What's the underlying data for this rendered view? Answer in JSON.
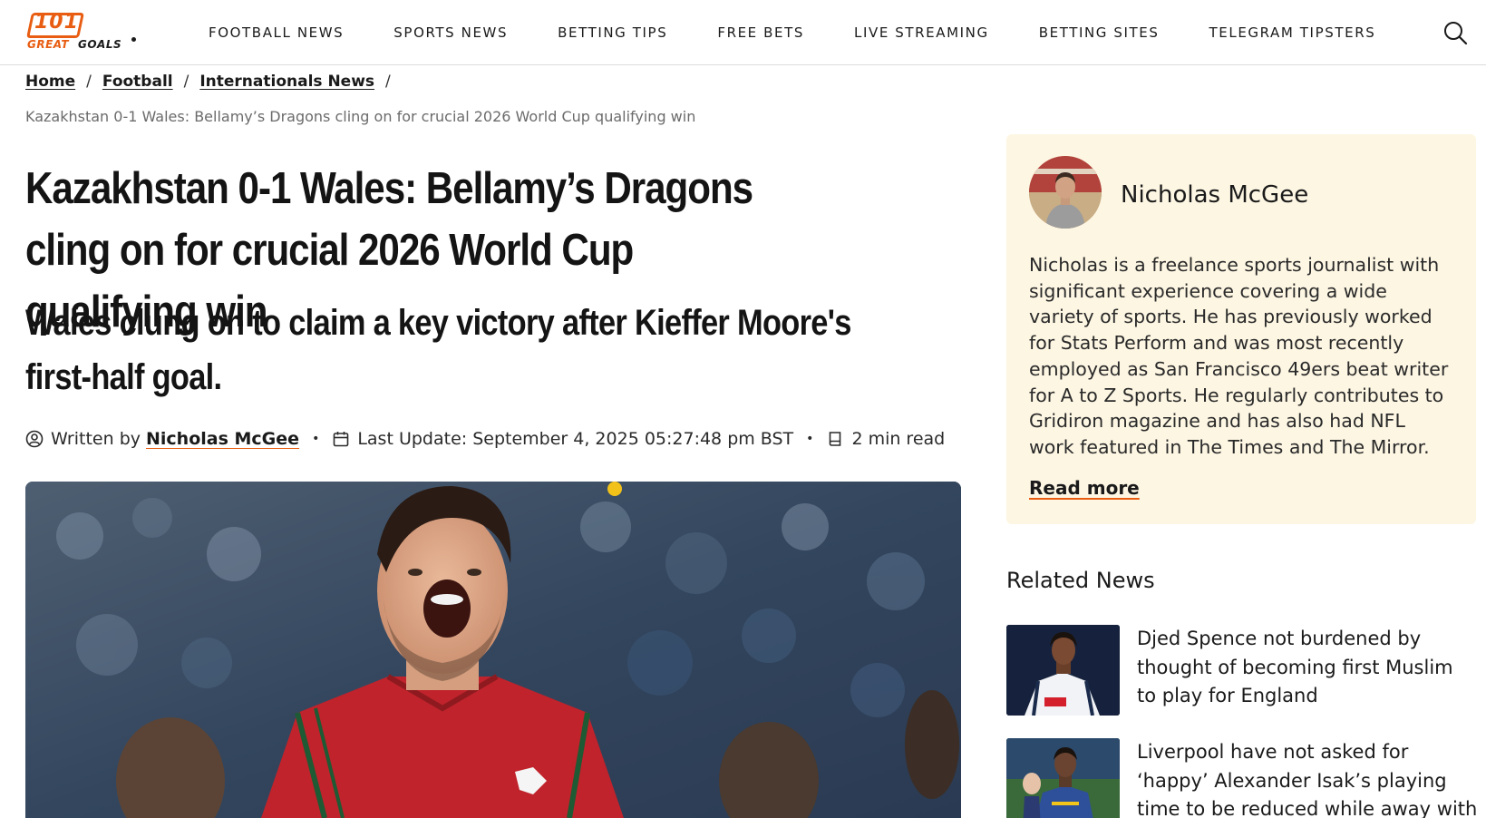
{
  "brand": {
    "logo_number": "101",
    "logo_great": "GREAT",
    "logo_goals": "GOALS",
    "accent_color": "#e85d12"
  },
  "nav": {
    "items": [
      "FOOTBALL NEWS",
      "SPORTS NEWS",
      "BETTING TIPS",
      "FREE BETS",
      "LIVE STREAMING",
      "BETTING SITES",
      "TELEGRAM TIPSTERS"
    ],
    "search_icon": "search-icon"
  },
  "breadcrumb": {
    "items": [
      "Home",
      "Football",
      "Internationals News"
    ],
    "separator": "/",
    "current": "Kazakhstan 0-1 Wales: Bellamy’s Dragons cling on for crucial 2026 World Cup qualifying win"
  },
  "article": {
    "title": "Kazakhstan 0-1 Wales: Bellamy’s Dragons cling on for crucial 2026 World Cup qualifying win",
    "subtitle": "Wales clung on to claim a key victory after Kieffer Moore's first-half goal.",
    "written_by_label": "Written by",
    "author": "Nicholas McGee",
    "bullet": "•",
    "last_update": "Last Update: September 4, 2025 05:27:48 pm BST",
    "read_time": "2 min read"
  },
  "author_card": {
    "name": "Nicholas McGee",
    "bio": "Nicholas is a freelance sports journalist with significant experience covering a wide variety of sports. He has previously worked for Stats Perform and was most recently employed as San Francisco 49ers beat writer for A to Z Sports. He regularly contributes to Gridiron magazine and has also had NFL work featured in The Times and The Mirror.",
    "read_more": "Read more",
    "background": "#fdf6e3"
  },
  "related": {
    "title": "Related News",
    "items": [
      {
        "headline": "Djed Spence not burdened by thought of becoming first Muslim to play for England"
      },
      {
        "headline": "Liverpool have not asked for ‘happy’ Alexander Isak’s playing time to be reduced while away with Sweden"
      }
    ]
  }
}
